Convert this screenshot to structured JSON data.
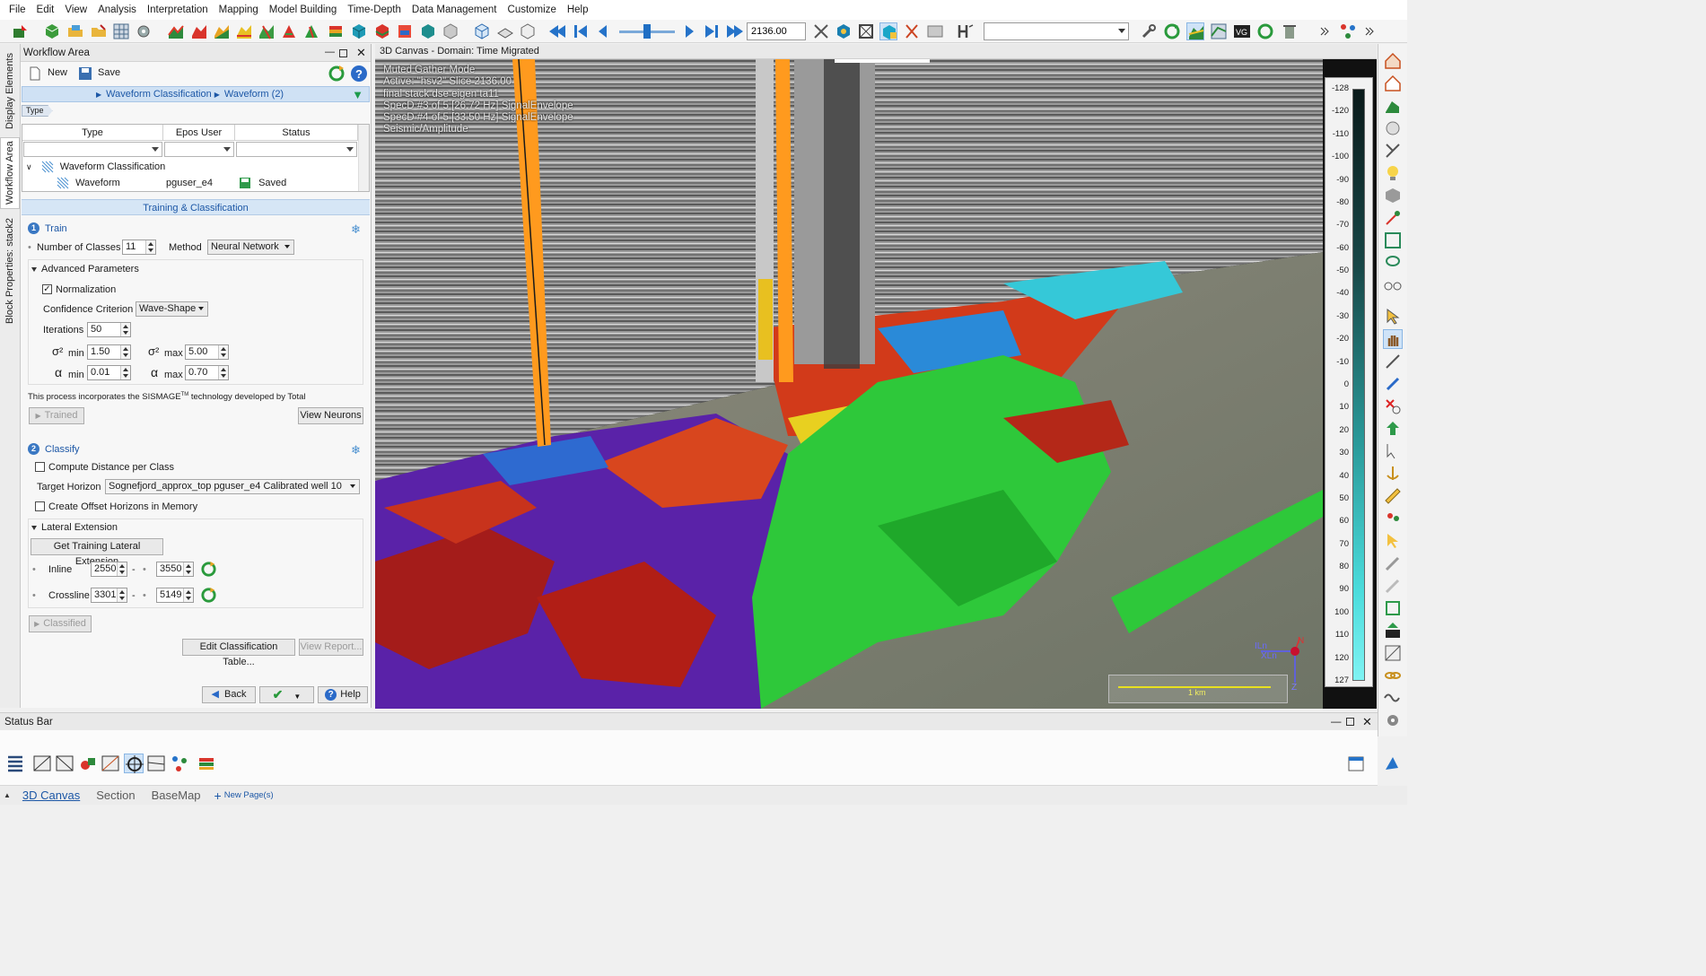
{
  "menu": [
    "File",
    "Edit",
    "View",
    "Analysis",
    "Interpretation",
    "Mapping",
    "Model Building",
    "Time-Depth",
    "Data Management",
    "Customize",
    "Help"
  ],
  "toolbar": {
    "slice_value": "2136.00"
  },
  "vtabs": [
    "Display Elements",
    "Workflow Area",
    "Block Properties: stack2"
  ],
  "workflow": {
    "title": "Workflow Area",
    "new_label": "New",
    "save_label": "Save",
    "breadcrumb": [
      "Waveform Classification",
      "Waveform (2)"
    ],
    "type_tag": "Type",
    "columns": [
      "Type",
      "Epos User",
      "Status"
    ],
    "tree": {
      "parent": "Waveform Classification",
      "child_type": "Waveform",
      "child_user": "pguser_e4",
      "child_status": "Saved"
    },
    "section_header": "Training & Classification",
    "train": {
      "step": "1",
      "title": "Train",
      "num_classes_label": "Number of Classes",
      "num_classes": "11",
      "method_label": "Method",
      "method": "Neural Network",
      "advanced_label": "Advanced Parameters",
      "normalization_label": "Normalization",
      "normalization_checked": true,
      "confidence_label": "Confidence Criterion",
      "confidence": "Wave-Shape",
      "iterations_label": "Iterations",
      "iterations": "50",
      "sigma_symbol": "σ²",
      "alpha_symbol": "α",
      "min_label": "min",
      "max_label": "max",
      "sigma_min": "1.50",
      "sigma_max": "5.00",
      "alpha_min": "0.01",
      "alpha_max": "0.70",
      "note_prefix": "This process incorporates the SISMAGE",
      "note_tm": "TM",
      "note_suffix": " technology developed by Total",
      "trained_label": "Trained",
      "view_neurons_label": "View Neurons"
    },
    "classify": {
      "step": "2",
      "title": "Classify",
      "compute_distance_label": "Compute Distance per Class",
      "target_horizon_label": "Target Horizon",
      "target_horizon": "Sognefjord_approx_top pguser_e4 Calibrated well 10",
      "offset_label": "Create Offset Horizons in Memory",
      "lateral_label": "Lateral Extension",
      "get_training_label": "Get Training Lateral Extension",
      "inline_label": "Inline",
      "inline_from": "2550",
      "inline_to": "3550",
      "crossline_label": "Crossline",
      "crossline_from": "3301",
      "crossline_to": "5149",
      "dash": "-",
      "classified_label": "Classified",
      "edit_table_label": "Edit Classification Table...",
      "view_report_label": "View Report..."
    },
    "back_label": "Back",
    "help_label": "Help"
  },
  "canvas": {
    "title": "3D Canvas - Domain: Time Migrated",
    "overlay": [
      "Muted Gather Mode",
      "Active: \"hsv2\" Slice 2136.00",
      "final stack dse eigen ta11",
      "SpecD #3 of 5 [26.72 Hz] SignalEnvelope",
      "SpecD #4 of 5 [33.50 Hz] SignalEnvelope",
      "Seismic/Amplitude"
    ],
    "colorbar_ticks": [
      "-128",
      "-120",
      "-110",
      "-100",
      "-90",
      "-80",
      "-70",
      "-60",
      "-50",
      "-40",
      "-30",
      "-20",
      "-10",
      "0",
      "10",
      "20",
      "30",
      "40",
      "50",
      "60",
      "70",
      "80",
      "90",
      "100",
      "110",
      "120",
      "127"
    ],
    "scale_label": "1 km",
    "compass": {
      "north": "N",
      "z": "Z",
      "inline": "ILn",
      "crossline": "XLn"
    }
  },
  "status": {
    "title": "Status Bar"
  },
  "pages": [
    "3D Canvas",
    "Section",
    "BaseMap"
  ],
  "new_page_label": "New Page(s)",
  "colors": {
    "accent": "#1c57a6",
    "breadcrumb_bg": "#cfe1f4",
    "well_orange": "#ff9a1e"
  }
}
